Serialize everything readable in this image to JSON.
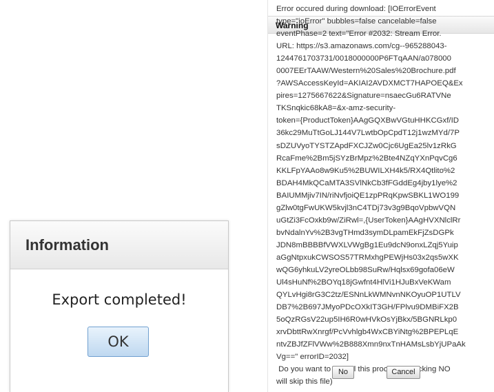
{
  "info_dialog": {
    "title": "Information",
    "message": "Export completed!",
    "ok_label": "OK"
  },
  "warning_dialog": {
    "title": "Warning",
    "message_lines": [
      "Error occured during download: [IOErrorEvent",
      "type=\"ioError\" bubbles=false cancelable=false",
      "eventPhase=2 text=\"Error #2032: Stream Error.",
      "URL: https://s3.amazonaws.com/cg--965288043-",
      "1244761703731/0018000000P6FTqAAN/a078000",
      "0007EErTAAW/Western%20Sales%20Brochure.pdf",
      "?AWSAccessKeyId=AKIAI2AVDXMCT7HAPOEQ&Ex",
      "pires=1275667622&Signature=nsaecGu6RATVNe",
      "TKSnqkic68kA8=&x-amz-security-",
      "token={ProductToken}AAgGQXBwVGtuHHKCGxf/ID",
      "36kc29MuTtGoLJ144V7LwtbOpCpdT12j1wzMYd/7P",
      "sDZUVyoTYSTZApdFXCJZw0Cjc6UgEa25lv1zRkG",
      "RcaFme%2Bm5jSYzBrMpz%2Bte4NZqYXnPqvCg6",
      "KKLFpYAAo8w9Ku5%2BUWILXH4k5/RX4Qtlito%2",
      "BDAH4MkQCaMTA3SVlNkCb3fFGddEg4jby1lye%2",
      "BAIUMMjiv7IN/riNvfjoiQE1zpPRqKpwSBKL1WO199",
      "gZlw0tgFwUKW5kvjl3nC4TDj73v3g9BqoVpbwVQN",
      "uGtZi3FcOxkb9w/ZiRwl=,{UserToken}AAgHVXNlclRr",
      "bvNdalnYv%2B3vgTHmd3symDLpamEkFjZsDGPk",
      "JDN8mBBBBfVWXLVWgBg1Eu9dcN9onxLZqj5Yuip",
      "aGgNtpxukCWSOS57TRMxhgPEWjHs03x2qs5wXK",
      "wQG6yhkuLV2yreOLbb98SuRw/Hqlsx69gofa06eW",
      "Ul4sHuNf%2BOYq18jGwfnt4HlVi1HJuBxVeKWam",
      "QYLvHgi8rG3C2tz/ESNnLkWMNvnNKOyuOP1UTLV",
      "DB7%2B697JMyoPDcOXkIT3GH/FPlvu9DMBiFX2B",
      "5oQzRGsV22up5IH6R0wHVkOsYjBkx/5BGNRLkp0",
      "xrvDbttRwXnrgf/PcVvhlgb4WxCBYiNtg%2BPEPLqE",
      "ntvZBJfZFlVWw%2B888Xmn9nxTnHAMsLsbYjUPaAk",
      "Vg==\" errorID=2032]",
      " Do you want to cancel this process? (Clicking NO",
      "will skip this file)"
    ],
    "no_label": "No",
    "cancel_label": "Cancel"
  },
  "colors": {
    "ok_button_border": "#6f9fcf",
    "ok_button_fill": "#bfd8f0",
    "titlebar_fill": "#e8e8e8"
  }
}
